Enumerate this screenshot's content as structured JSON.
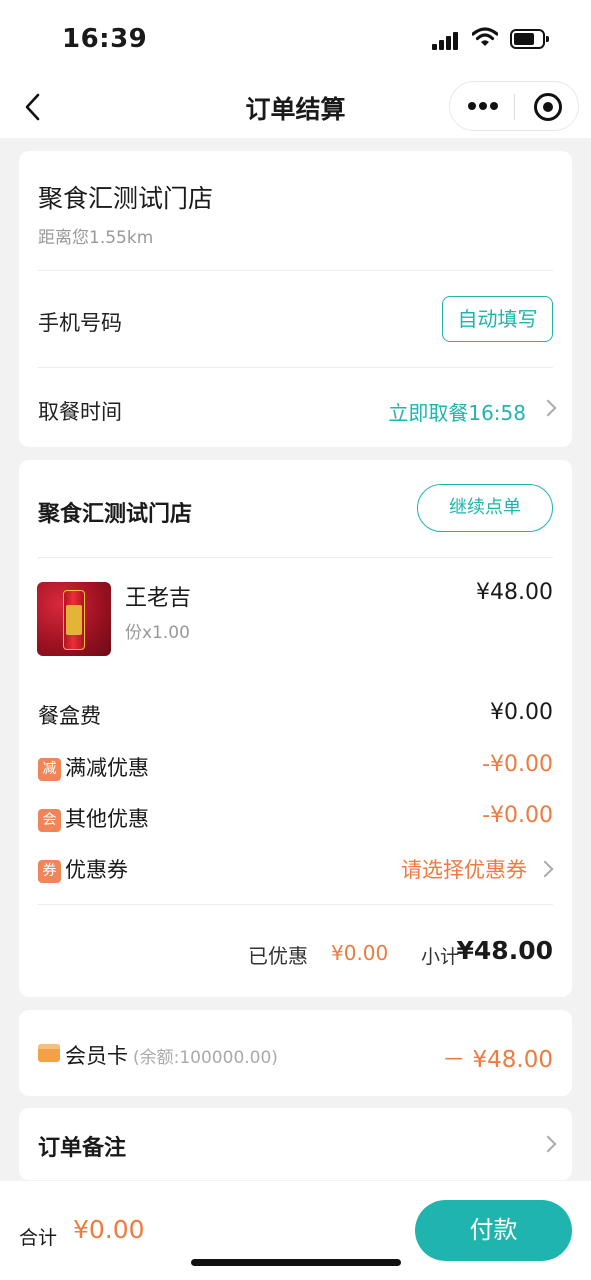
{
  "status_bar": {
    "time": "16:39"
  },
  "nav": {
    "title": "订单结算"
  },
  "store_card": {
    "store_name": "聚食汇测试门店",
    "distance": "距离您1.55km",
    "phone_label": "手机号码",
    "autofill_label": "自动填写",
    "pickup_label": "取餐时间",
    "pickup_value": "立即取餐16:58"
  },
  "order_card": {
    "store_name": "聚食汇测试门店",
    "continue_label": "继续点单",
    "items": [
      {
        "name": "王老吉",
        "quantity": "份x1.00",
        "price": "¥48.00"
      }
    ],
    "box_fee": {
      "label": "餐盒费",
      "value": "¥0.00"
    },
    "full_discount": {
      "tag": "减",
      "label": "满减优惠",
      "value": "-¥0.00"
    },
    "other_discount": {
      "tag": "会",
      "label": "其他优惠",
      "value": "-¥0.00"
    },
    "coupon": {
      "tag": "券",
      "label": "优惠券",
      "value": "请选择优惠券"
    },
    "saved_label": "已优惠",
    "saved_value": "¥0.00",
    "subtotal_label": "小计",
    "subtotal_value": "¥48.00"
  },
  "member_card": {
    "label": "会员卡",
    "balance": "(余额:100000.00)",
    "amount": "－ ¥48.00"
  },
  "remark": {
    "label": "订单备注"
  },
  "bottom_bar": {
    "total_label": "合计",
    "total_value": "¥0.00",
    "pay_label": "付款"
  },
  "colors": {
    "accent": "#1fb5ae",
    "discount": "#f07a3f",
    "background": "#f2f2f2"
  }
}
